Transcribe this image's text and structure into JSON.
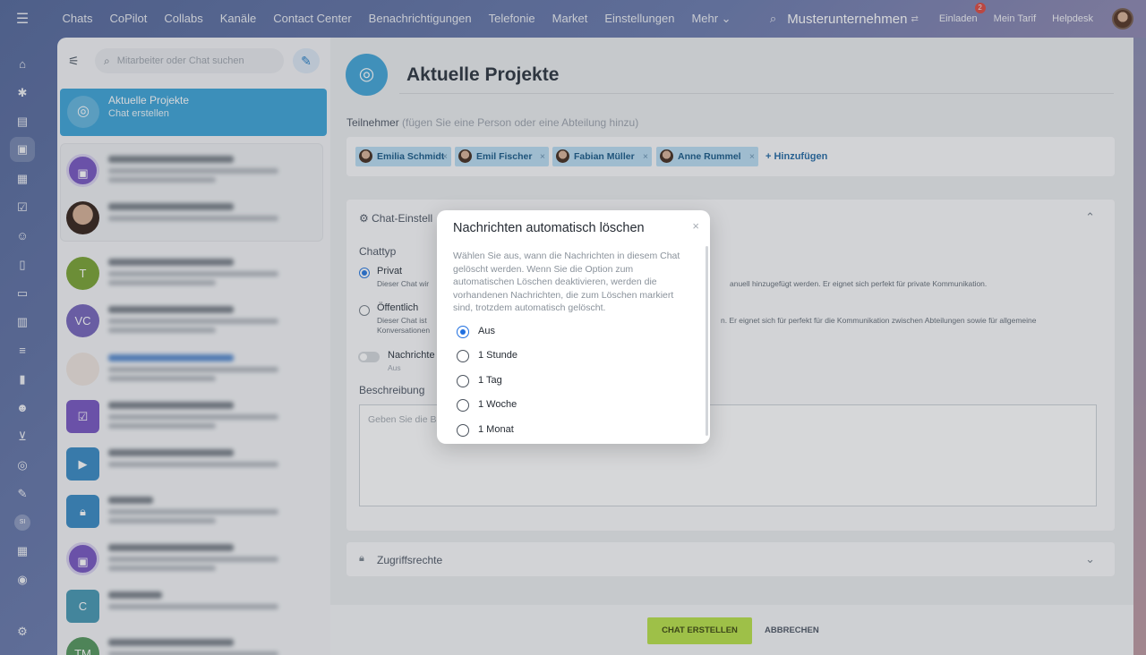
{
  "topbar": {
    "nav": [
      "Chats",
      "CoPilot",
      "Collabs",
      "Kanäle",
      "Contact Center",
      "Benachrichtigungen",
      "Telefonie",
      "Market",
      "Einstellungen",
      "Mehr ⌄"
    ],
    "company": "Musterunternehmen",
    "invite": "Einladen",
    "invite_badge": "2",
    "plan": "Mein Tarif",
    "helpdesk": "Helpdesk"
  },
  "leftrail": {
    "user_initials": "SI"
  },
  "chatlist": {
    "search_placeholder": "Mitarbeiter oder Chat suchen",
    "active": {
      "title": "Aktuelle Projekte",
      "subtitle": "Chat erstellen"
    },
    "avatars": [
      "T",
      "VC",
      "C",
      "TM"
    ]
  },
  "main": {
    "title": "Aktuelle Projekte",
    "members_label": "Teilnehmer",
    "members_hint": "(fügen Sie eine Person oder eine Abteilung hinzu)",
    "members": [
      "Emilia Schmidt",
      "Emil Fischer",
      "Fabian Müller",
      "Anne Rummel"
    ],
    "add_label": "+ Hinzufügen",
    "settings_header": "Chat-Einstell",
    "chat_type_label": "Chattyp",
    "private_label": "Privat",
    "private_desc_start": "Dieser Chat wir",
    "private_desc_end": "anuell hinzugefügt werden. Er eignet sich perfekt für private Kommunikation.",
    "public_label": "Öffentlich",
    "public_desc_start": "Dieser Chat ist",
    "public_desc_start2": "Konversationen",
    "public_desc_end": "n. Er eignet sich für perfekt für die Kommunikation zwischen Abteilungen sowie für allgemeine",
    "messages_label": "Nachrichte",
    "messages_sub": "Aus",
    "description_label": "Beschreibung",
    "description_placeholder": "Geben Sie die B",
    "access_label": "Zugriffsrechte",
    "create_button": "CHAT ERSTELLEN",
    "cancel_button": "ABBRECHEN"
  },
  "dialog": {
    "title": "Nachrichten automatisch löschen",
    "text": "Wählen Sie aus, wann die Nachrichten in diesem Chat gelöscht werden. Wenn Sie die Option zum automatischen Löschen deaktivieren, werden die vorhandenen Nachrichten, die zum Löschen markiert sind, trotzdem automatisch gelöscht.",
    "options": [
      "Aus",
      "1 Stunde",
      "1 Tag",
      "1 Woche",
      "1 Monat"
    ],
    "selected": "Aus"
  },
  "colors": {
    "accent": "#44a8d9",
    "create_button": "#bbe34f",
    "radio_selected": "#1f6fe0"
  }
}
